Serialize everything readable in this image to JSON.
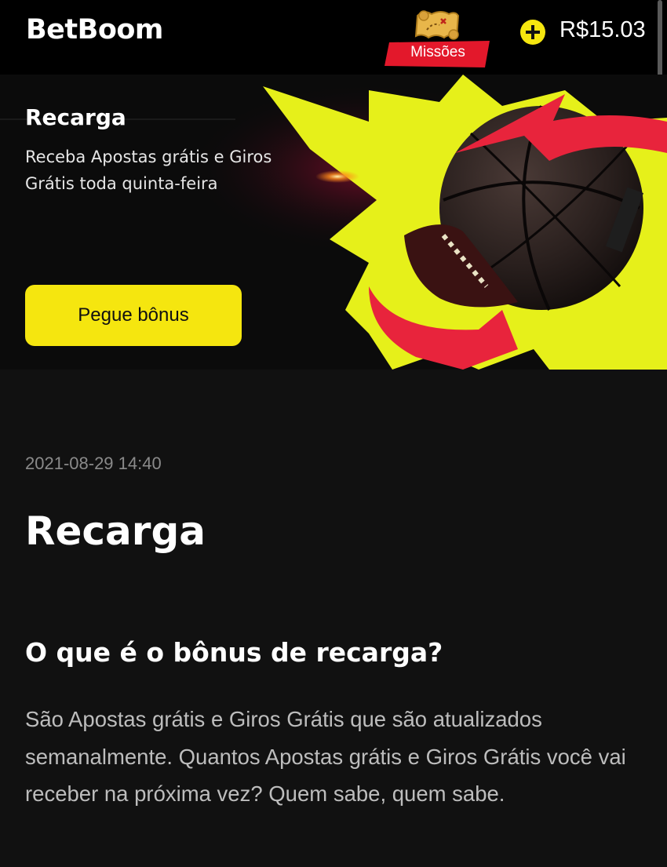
{
  "header": {
    "brand": "BetBoom",
    "missions_label": "Missões",
    "balance": "R$15.03"
  },
  "banner": {
    "title": "Recarga",
    "subtitle": "Receba Apostas grátis e Giros Grátis toda quinta-feira",
    "button_label": "Pegue bônus"
  },
  "article": {
    "date": "2021-08-29 14:40",
    "title": "Recarga",
    "heading": "O que é o bônus de recarga?",
    "body": "São Apostas grátis e Giros Grátis que são atualizados semanalmente. Quantos Apostas grátis e Giros Grátis você vai receber na próxima vez? Quem sabe, quem sabe."
  },
  "colors": {
    "accent_yellow": "#f5e60f",
    "ribbon_red": "#e3182b",
    "background": "#111111"
  }
}
